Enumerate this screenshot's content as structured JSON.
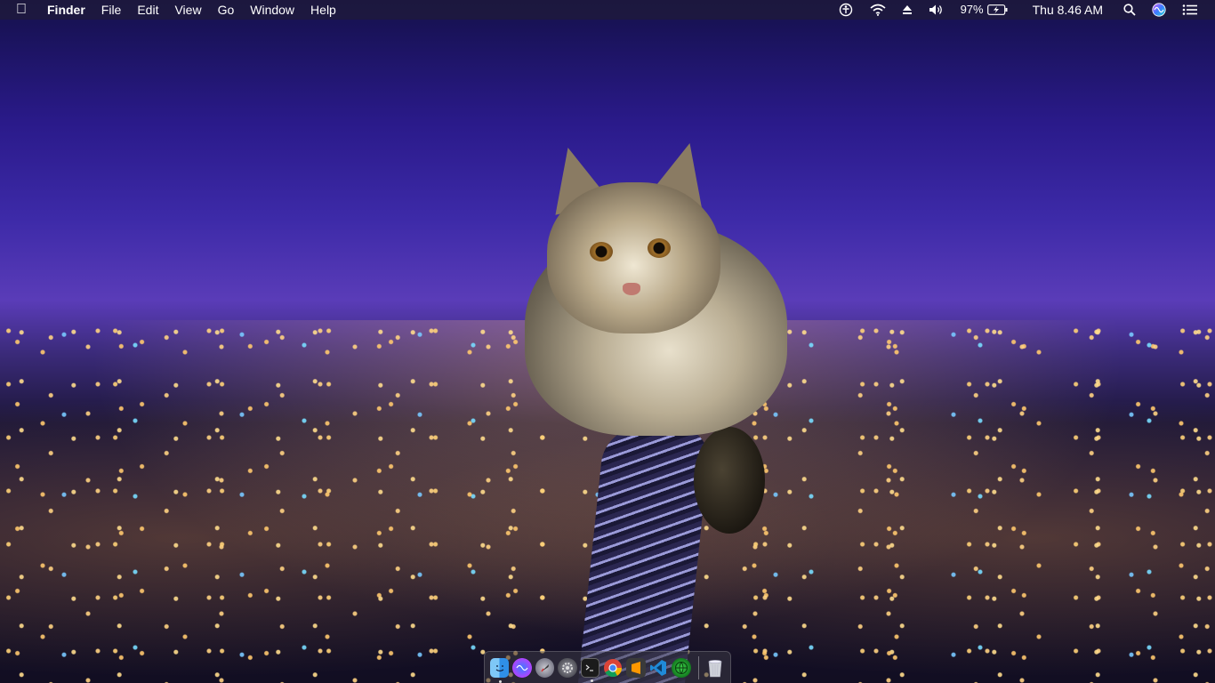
{
  "menubar": {
    "app_name": "Finder",
    "menus": [
      "File",
      "Edit",
      "View",
      "Go",
      "Window",
      "Help"
    ],
    "battery": "97%",
    "clock": "Thu 8.46 AM"
  },
  "dock": {
    "apps": [
      {
        "name": "Finder",
        "icon": "finder-icon",
        "running": true
      },
      {
        "name": "Siri",
        "icon": "siri-icon",
        "running": false
      },
      {
        "name": "Launchpad",
        "icon": "launchpad-icon",
        "running": false
      },
      {
        "name": "System Preferences",
        "icon": "system-preferences-icon",
        "running": false
      },
      {
        "name": "Terminal",
        "icon": "terminal-icon",
        "running": true
      },
      {
        "name": "Chrome",
        "icon": "chrome-icon",
        "running": false
      },
      {
        "name": "Sublime Text",
        "icon": "sublime-text-icon",
        "running": false
      },
      {
        "name": "Visual Studio Code",
        "icon": "vscode-icon",
        "running": false
      },
      {
        "name": "Web Browser",
        "icon": "globe-icon",
        "running": false
      }
    ],
    "trash": {
      "name": "Trash",
      "icon": "trash-icon"
    }
  },
  "colors": {
    "menubar_bg": "#1e1a3c",
    "sky_top": "#14104a",
    "sky_mid": "#3d2aa8"
  }
}
